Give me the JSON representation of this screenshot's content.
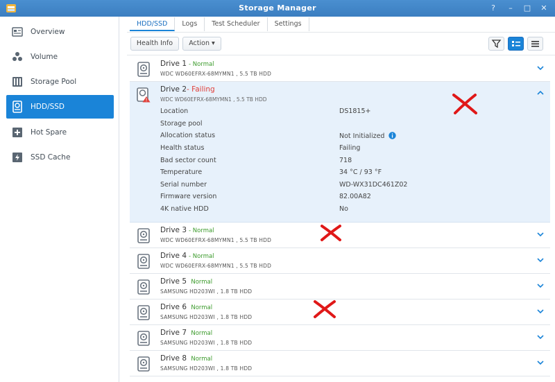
{
  "window": {
    "title": "Storage Manager",
    "buttons": [
      "?",
      "–",
      "□",
      "✕"
    ]
  },
  "sidebar": {
    "items": [
      {
        "label": "Overview",
        "icon": "overview-icon"
      },
      {
        "label": "Volume",
        "icon": "volume-icon"
      },
      {
        "label": "Storage Pool",
        "icon": "storage-pool-icon"
      },
      {
        "label": "HDD/SSD",
        "icon": "hdd-icon",
        "active": true
      },
      {
        "label": "Hot Spare",
        "icon": "hot-spare-icon"
      },
      {
        "label": "SSD Cache",
        "icon": "ssd-cache-icon"
      }
    ]
  },
  "tabs": [
    "HDD/SSD",
    "Logs",
    "Test Scheduler",
    "Settings"
  ],
  "toolbar": {
    "health_info": "Health Info",
    "action": "Action ▾"
  },
  "drives": [
    {
      "name": "Drive 1",
      "status": "- Normal",
      "desc": "WDC WD60EFRX-68MYMN1 , 5.5 TB HDD"
    },
    {
      "name": "Drive 2",
      "status": "- Failing",
      "desc": "WDC WD60EFRX-68MYMN1 , 5.5 TB HDD"
    },
    {
      "name": "Drive 3",
      "status": "- Normal",
      "desc": "WDC WD60EFRX-68MYMN1 , 5.5 TB HDD"
    },
    {
      "name": "Drive 4",
      "status": "- Normal",
      "desc": "WDC WD60EFRX-68MYMN1 , 5.5 TB HDD"
    },
    {
      "name": "Drive 5",
      "status": "Normal",
      "desc": "SAMSUNG HD203WI , 1.8 TB HDD"
    },
    {
      "name": "Drive 6",
      "status": "Normal",
      "desc": "SAMSUNG HD203WI , 1.8 TB HDD"
    },
    {
      "name": "Drive 7",
      "status": "Normal",
      "desc": "SAMSUNG HD203WI , 1.8 TB HDD"
    },
    {
      "name": "Drive 8",
      "status": "Normal",
      "desc": "SAMSUNG HD203WI , 1.8 TB HDD"
    }
  ],
  "details": [
    {
      "label": "Location",
      "value": "DS1815+"
    },
    {
      "label": "Storage pool",
      "value": ""
    },
    {
      "label": "Allocation status",
      "value": "Not Initialized"
    },
    {
      "label": "Health status",
      "value": "Failing"
    },
    {
      "label": "Bad sector count",
      "value": "718"
    },
    {
      "label": "Temperature",
      "value": "34 °C / 93 °F"
    },
    {
      "label": "Serial number",
      "value": "WD-WX31DC461Z02"
    },
    {
      "label": "Firmware version",
      "value": "82.00A82"
    },
    {
      "label": "4K native HDD",
      "value": "No"
    }
  ],
  "colors": {
    "accent": "#1a84d8",
    "normal": "#3a9a2a",
    "failing": "#e0403a",
    "annotation": "#e01818"
  }
}
